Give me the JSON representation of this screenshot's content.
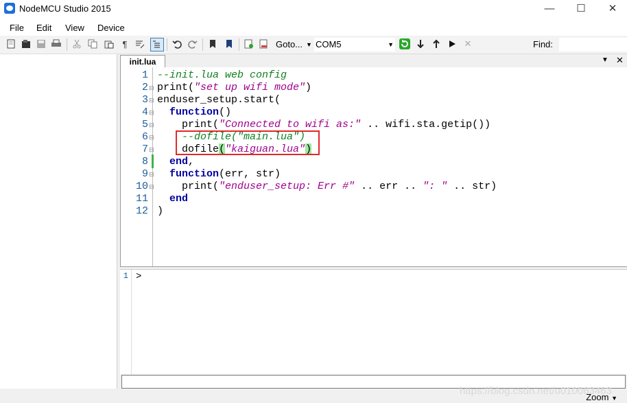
{
  "window": {
    "title": "NodeMCU Studio 2015",
    "minimize": "—",
    "maximize": "☐",
    "close": "✕"
  },
  "menu": [
    "File",
    "Edit",
    "View",
    "Device"
  ],
  "toolbar": {
    "goto_label": "Goto...",
    "port_value": "COM5",
    "find_label": "Find:",
    "find_value": ""
  },
  "tab": {
    "filename": "init.lua",
    "dropdown_icon": "▼",
    "close_icon": "✕"
  },
  "editor": {
    "line_numbers": [
      "1",
      "2",
      "3",
      "4",
      "5",
      "6",
      "7",
      "8",
      "9",
      "10",
      "11",
      "12"
    ],
    "lines": [
      "--init.lua web config",
      "print(\"set up wifi mode\")",
      "enduser_setup.start(",
      "  function()",
      "    print(\"Connected to wifi as:\" .. wifi.sta.getip())",
      "    --dofile(\"main.lua\")",
      "    dofile(\"kaiguan.lua\")",
      "  end,",
      "  function(err, str)",
      "    print(\"enduser_setup: Err #\" .. err .. \": \" .. str)",
      "  end",
      ")"
    ]
  },
  "console": {
    "line_number": "1",
    "prompt": ">"
  },
  "status": {
    "zoom_label": "Zoom",
    "watermark": "https://blog.csdn.net/u010063463"
  }
}
